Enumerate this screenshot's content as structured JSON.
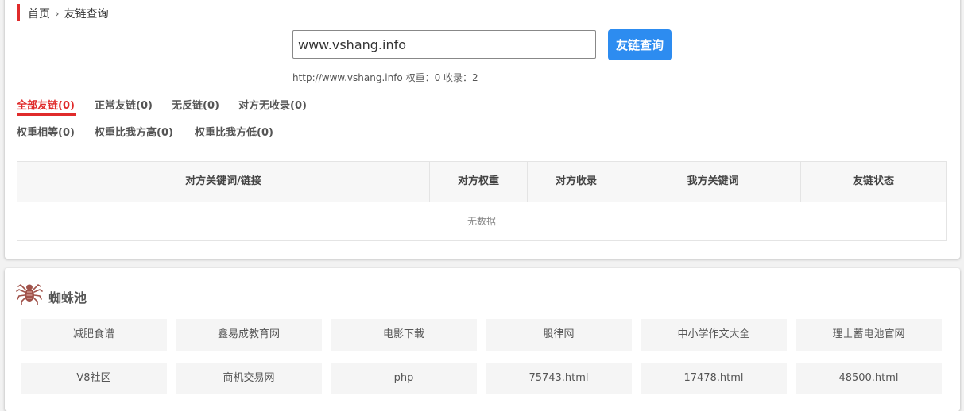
{
  "breadcrumb": {
    "home": "首页",
    "separator": "›",
    "current": "友链查询"
  },
  "search": {
    "value": "www.vshang.info",
    "button": "友链查询"
  },
  "site_info": "http://www.vshang.info 权重：0 收录：2",
  "filters": [
    {
      "label": "全部友链(0)",
      "active": true
    },
    {
      "label": "正常友链(0)"
    },
    {
      "label": "无反链(0)"
    },
    {
      "label": "对方无收录(0)"
    },
    {
      "label": "权重相等(0)"
    },
    {
      "label": "权重比我方高(0)"
    },
    {
      "label": "权重比我方低(0)"
    }
  ],
  "table": {
    "headers": [
      "对方关键词/链接",
      "对方权重",
      "对方收录",
      "我方关键词",
      "友链状态"
    ],
    "empty_text": "无数据"
  },
  "spider_pool": {
    "title": "蜘蛛池",
    "items": [
      "减肥食谱",
      "鑫易成教育网",
      "电影下载",
      "股律网",
      "中小学作文大全",
      "理士蓄电池官网",
      "V8社区",
      "商机交易网",
      "php",
      "75743.html",
      "17478.html",
      "48500.html"
    ]
  },
  "colors": {
    "accent": "#e02b2b",
    "button": "#2d8cf0"
  }
}
